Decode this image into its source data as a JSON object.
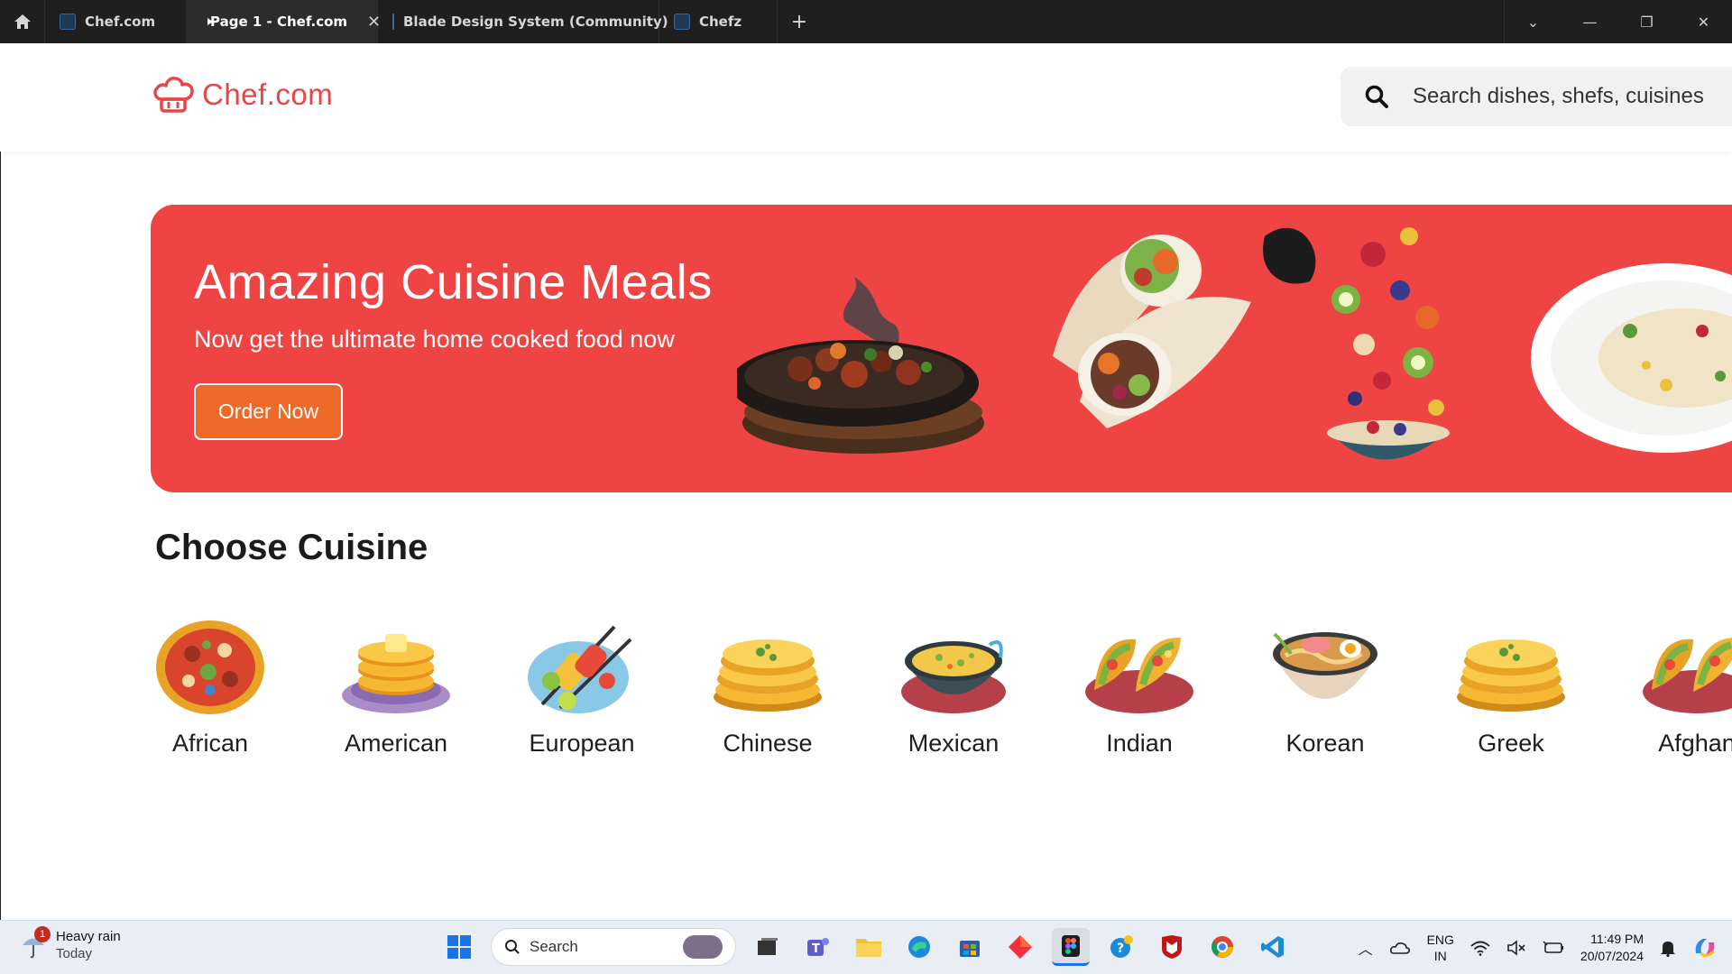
{
  "browser": {
    "tabs": [
      {
        "label": "Chef.com",
        "active": false
      },
      {
        "label": "Page 1 - Chef.com",
        "active": true
      },
      {
        "label": "Blade Design System (Community)",
        "active": false
      },
      {
        "label": "Chefz",
        "active": false
      }
    ],
    "new_tab": "+"
  },
  "header": {
    "logo_text": "Chef.com",
    "search_placeholder": "Search dishes, shefs, cuisines"
  },
  "hero": {
    "title": "Amazing Cuisine Meals",
    "subtitle": "Now get the ultimate home cooked food now",
    "cta_label": "Order Now"
  },
  "cuisines": {
    "title": "Choose Cuisine",
    "items": [
      {
        "label": "African",
        "icon": "pizza-icon"
      },
      {
        "label": "American",
        "icon": "pancakes-icon"
      },
      {
        "label": "European",
        "icon": "skewers-icon"
      },
      {
        "label": "Chinese",
        "icon": "flatbread-icon"
      },
      {
        "label": "Mexican",
        "icon": "stew-pot-icon"
      },
      {
        "label": "Indian",
        "icon": "tacos-icon"
      },
      {
        "label": "Korean",
        "icon": "ramen-icon"
      },
      {
        "label": "Greek",
        "icon": "flatbread-icon"
      },
      {
        "label": "Afghan",
        "icon": "tacos-icon"
      }
    ]
  },
  "taskbar": {
    "weather_title": "Heavy rain",
    "weather_sub": "Today",
    "weather_badge": "1",
    "search_label": "Search",
    "lang_top": "ENG",
    "lang_bottom": "IN",
    "time": "11:49 PM",
    "date": "20/07/2024"
  },
  "colors": {
    "brand_red": "#e84545",
    "hero_bg": "#ef4444",
    "cta_orange": "#ee6a28"
  }
}
